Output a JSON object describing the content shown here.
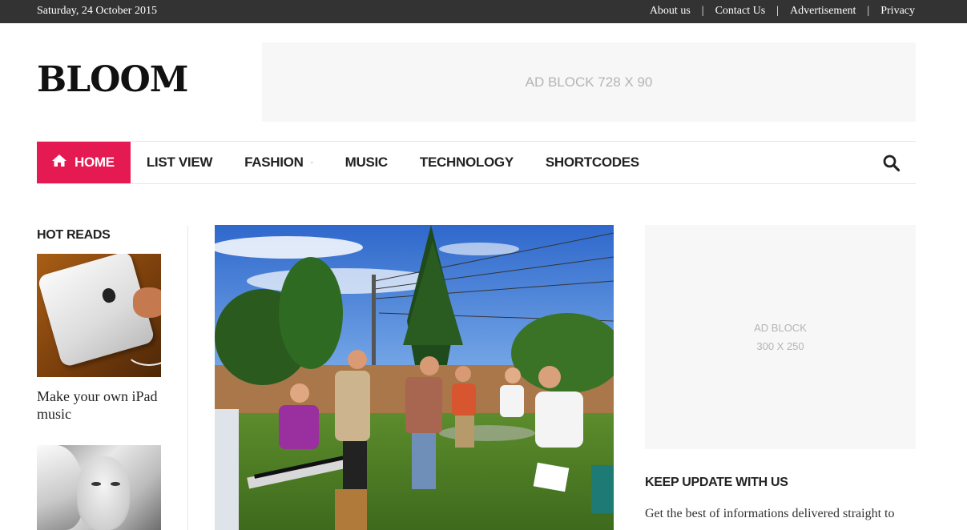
{
  "topbar": {
    "date": "Saturday, 24 October 2015",
    "links": [
      "About us",
      "Contact Us",
      "Advertisement",
      "Privacy"
    ],
    "separator": "|"
  },
  "header": {
    "logo": "BLOOM",
    "ad_banner": "AD BLOCK 728 X 90"
  },
  "nav": {
    "items": [
      {
        "label": "HOME",
        "active": true,
        "icon": "home-icon"
      },
      {
        "label": "LIST VIEW"
      },
      {
        "label": "FASHION",
        "has_dropdown": true
      },
      {
        "label": "MUSIC"
      },
      {
        "label": "TECHNOLOGY"
      },
      {
        "label": "SHORTCODES"
      }
    ],
    "caret": "-",
    "search_icon": "search-icon",
    "accent_color": "#e61a53"
  },
  "hot_reads": {
    "title": "HOT READS",
    "stories": [
      {
        "title": "Make your own iPad music"
      }
    ]
  },
  "sidebar": {
    "ad_line1": "AD BLOCK",
    "ad_line2": "300 X 250",
    "keep_title": "KEEP UPDATE WITH US",
    "keep_text": "Get the best of informations delivered straight to"
  },
  "colors": {
    "topbar_bg": "#333333",
    "ad_bg": "#f7f7f7",
    "ad_text": "#b4b4b4"
  }
}
